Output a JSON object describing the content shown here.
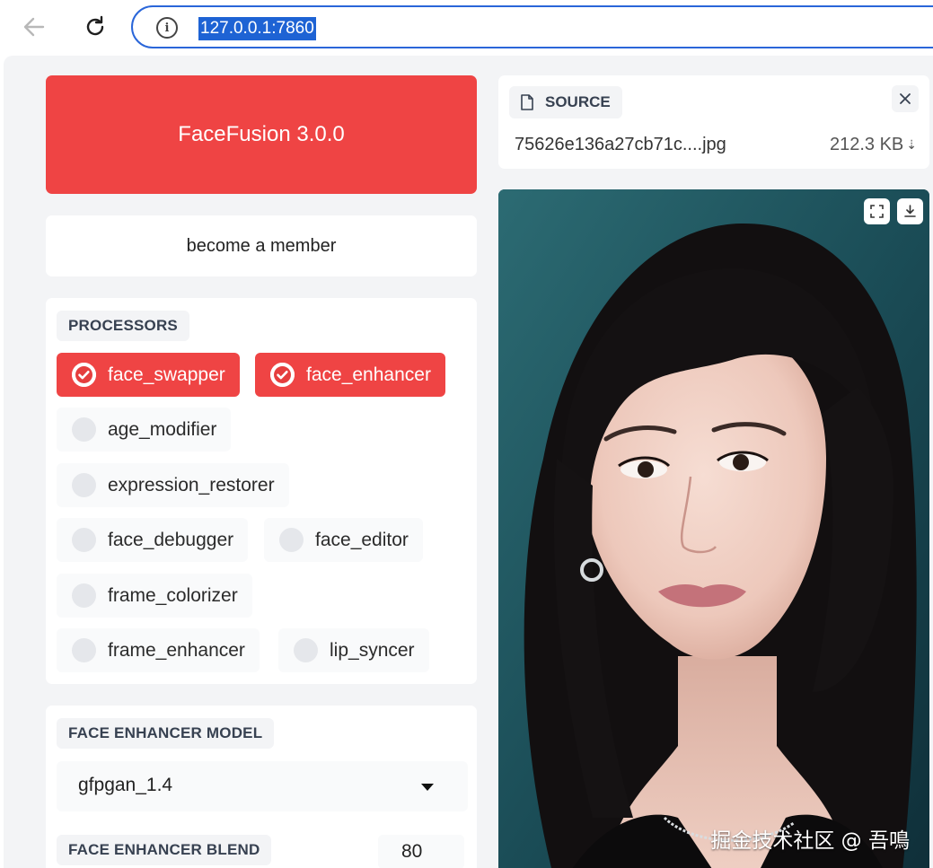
{
  "browser": {
    "url": "127.0.0.1:7860"
  },
  "header": {
    "title": "FaceFusion 3.0.0",
    "member_link": "become a member"
  },
  "processors": {
    "label": "PROCESSORS",
    "items": [
      {
        "label": "face_swapper",
        "checked": true
      },
      {
        "label": "face_enhancer",
        "checked": true
      },
      {
        "label": "age_modifier",
        "checked": false
      },
      {
        "label": "expression_restorer",
        "checked": false
      },
      {
        "label": "face_debugger",
        "checked": false
      },
      {
        "label": "face_editor",
        "checked": false
      },
      {
        "label": "frame_colorizer",
        "checked": false
      },
      {
        "label": "frame_enhancer",
        "checked": false
      },
      {
        "label": "lip_syncer",
        "checked": false
      }
    ]
  },
  "face_enhancer": {
    "model_label": "FACE ENHANCER MODEL",
    "model_value": "gfpgan_1.4",
    "blend_label": "FACE ENHANCER BLEND",
    "blend_value": "80"
  },
  "source": {
    "label": "SOURCE",
    "file_name": "75626e136a27cb71c....jpg",
    "file_size": "212.3 KB",
    "download_glyph": "⇣"
  },
  "preview": {
    "watermark": "掘金技术社区 @ 吾鳴"
  },
  "colors": {
    "accent": "#ef4444",
    "panel_bg": "#ffffff",
    "page_bg": "#f3f4f6",
    "omnibox_border": "#2a66d9"
  },
  "icons": [
    "back-arrow-icon",
    "reload-icon",
    "info-icon",
    "file-icon",
    "close-icon",
    "checkmark-icon",
    "fullscreen-icon",
    "download-icon",
    "dropdown-caret-icon"
  ]
}
